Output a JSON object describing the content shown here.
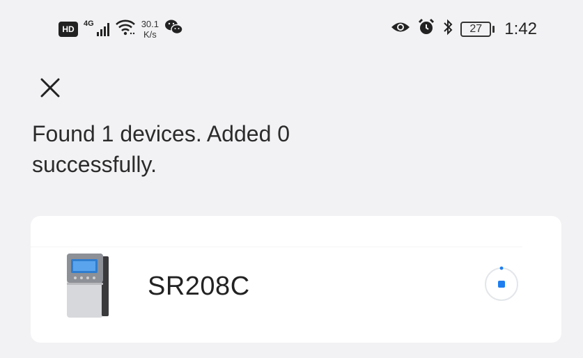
{
  "status_bar": {
    "hd_label": "HD",
    "network_type": "4G",
    "speed_value": "30.1",
    "speed_unit": "K/s",
    "battery_level": "27",
    "time": "1:42",
    "icons": [
      "hd-icon",
      "signal-icon",
      "wifi-icon",
      "wechat-icon",
      "eye-icon",
      "alarm-icon",
      "bluetooth-icon",
      "battery-icon"
    ]
  },
  "header": {
    "close_icon": "close-icon"
  },
  "message": "Found 1 devices. Added 0 successfully.",
  "devices": [
    {
      "name": "SR208C",
      "image_icon": "controller-device-icon",
      "status_icon": "adding-progress-icon"
    }
  ],
  "colors": {
    "background": "#f2f2f4",
    "card": "#ffffff",
    "accent": "#1e7ef0",
    "text": "#222222"
  }
}
